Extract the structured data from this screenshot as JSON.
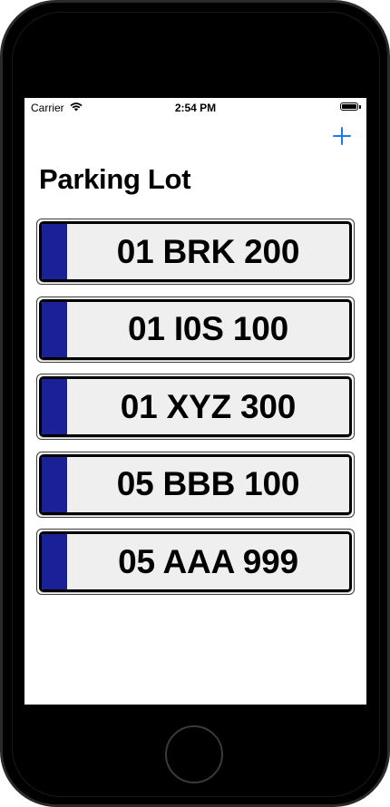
{
  "status_bar": {
    "carrier": "Carrier",
    "time": "2:54 PM",
    "wifi_icon": "wifi-icon",
    "battery_icon": "battery-icon"
  },
  "nav": {
    "title": "Parking Lot",
    "add_icon": "plus-icon",
    "accent_color": "#1a7cf5"
  },
  "plates": [
    {
      "number": "01 BRK 200"
    },
    {
      "number": "01 I0S 100"
    },
    {
      "number": "01 XYZ 300"
    },
    {
      "number": "05 BBB 100"
    },
    {
      "number": "05 AAA 999"
    }
  ],
  "plate_band_color": "#1a2196"
}
